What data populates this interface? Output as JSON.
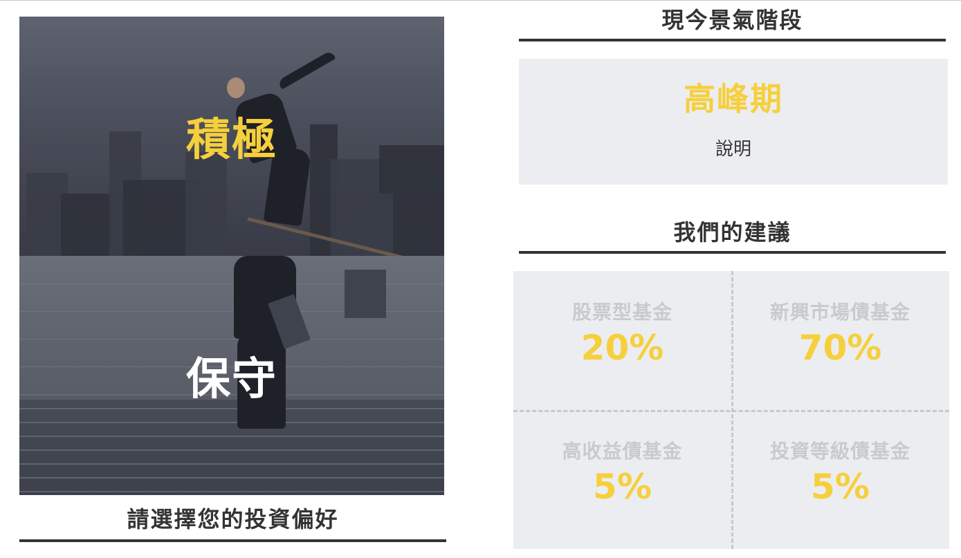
{
  "preference": {
    "options": [
      {
        "label": "積極",
        "image": "tightrope-city-photo"
      },
      {
        "label": "保守",
        "image": "stairs-climb-photo"
      }
    ],
    "title": "請選擇您的投資偏好"
  },
  "cycle": {
    "title": "現今景氣階段",
    "phase": "高峰期",
    "description": "說明"
  },
  "recommendation": {
    "title": "我們的建議",
    "allocations": [
      {
        "fund": "股票型基金",
        "percent": "20%"
      },
      {
        "fund": "新興市場債基金",
        "percent": "70%"
      },
      {
        "fund": "高收益債基金",
        "percent": "5%"
      },
      {
        "fund": "投資等級債基金",
        "percent": "5%"
      }
    ]
  },
  "colors": {
    "accent": "#f6cf3c",
    "panel": "#ecedf0",
    "text": "#333333",
    "muted": "#c9cacd"
  }
}
